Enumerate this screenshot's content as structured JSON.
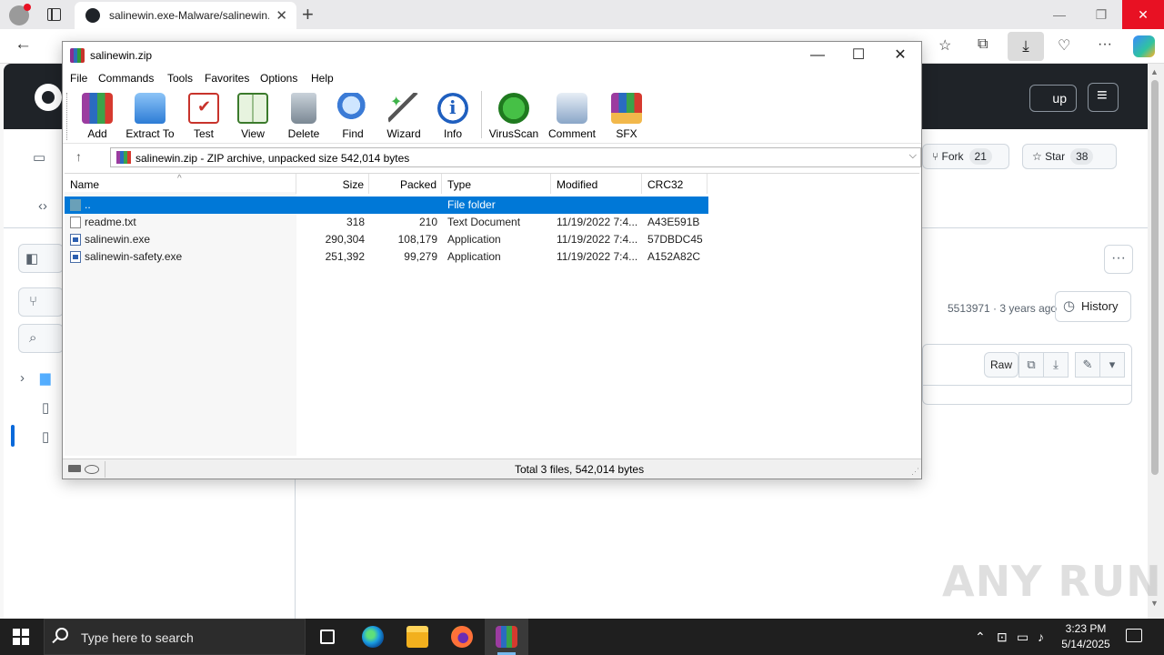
{
  "browser": {
    "tab_title": "salinewin.exe-Malware/salinewin.exe",
    "tab_close": "✕",
    "new_tab": "+",
    "win_minimize": "—",
    "win_restore": "❐",
    "win_close": "✕",
    "back": "←",
    "toolbar_icons": [
      "favorites-icon",
      "collections-icon",
      "downloads-icon",
      "performance-icon",
      "more-icon",
      "copilot-icon"
    ]
  },
  "github": {
    "signup_label": "up",
    "fork_label": "Fork",
    "fork_count": "21",
    "star_label": "Star",
    "star_count": "38",
    "commit_info": "5513971 · 3 years ago",
    "history_label": "History",
    "raw_label": "Raw",
    "more_label": "···"
  },
  "winrar": {
    "title": "salinewin.zip",
    "menu": [
      "File",
      "Commands",
      "Tools",
      "Favorites",
      "Options",
      "Help"
    ],
    "tools": [
      {
        "label": "Add",
        "icon": "add-icon"
      },
      {
        "label": "Extract To",
        "icon": "extract-to-icon"
      },
      {
        "label": "Test",
        "icon": "test-icon"
      },
      {
        "label": "View",
        "icon": "view-icon"
      },
      {
        "label": "Delete",
        "icon": "delete-icon"
      },
      {
        "label": "Find",
        "icon": "find-icon"
      },
      {
        "label": "Wizard",
        "icon": "wizard-icon"
      },
      {
        "label": "Info",
        "icon": "info-icon"
      },
      {
        "label": "VirusScan",
        "icon": "virusscan-icon"
      },
      {
        "label": "Comment",
        "icon": "comment-icon"
      },
      {
        "label": "SFX",
        "icon": "sfx-icon"
      }
    ],
    "path": "salinewin.zip - ZIP archive, unpacked size 542,014 bytes",
    "columns": {
      "name": "Name",
      "size": "Size",
      "packed": "Packed",
      "type": "Type",
      "modified": "Modified",
      "crc": "CRC32"
    },
    "rows": [
      {
        "name": "..",
        "size": "",
        "packed": "",
        "type": "File folder",
        "modified": "",
        "crc": "",
        "icon": "folder-icon"
      },
      {
        "name": "readme.txt",
        "size": "318",
        "packed": "210",
        "type": "Text Document",
        "modified": "11/19/2022 7:4...",
        "crc": "A43E591B",
        "icon": "text-file-icon"
      },
      {
        "name": "salinewin.exe",
        "size": "290,304",
        "packed": "108,179",
        "type": "Application",
        "modified": "11/19/2022 7:4...",
        "crc": "57DBDC45",
        "icon": "exe-file-icon"
      },
      {
        "name": "salinewin-safety.exe",
        "size": "251,392",
        "packed": "99,279",
        "type": "Application",
        "modified": "11/19/2022 7:4...",
        "crc": "A152A82C",
        "icon": "exe-file-icon"
      }
    ],
    "status": "Total 3 files, 542,014 bytes"
  },
  "taskbar": {
    "search_placeholder": "Type here to search",
    "time": "3:23 PM",
    "date": "5/14/2025"
  },
  "watermark": "ANY RUN"
}
